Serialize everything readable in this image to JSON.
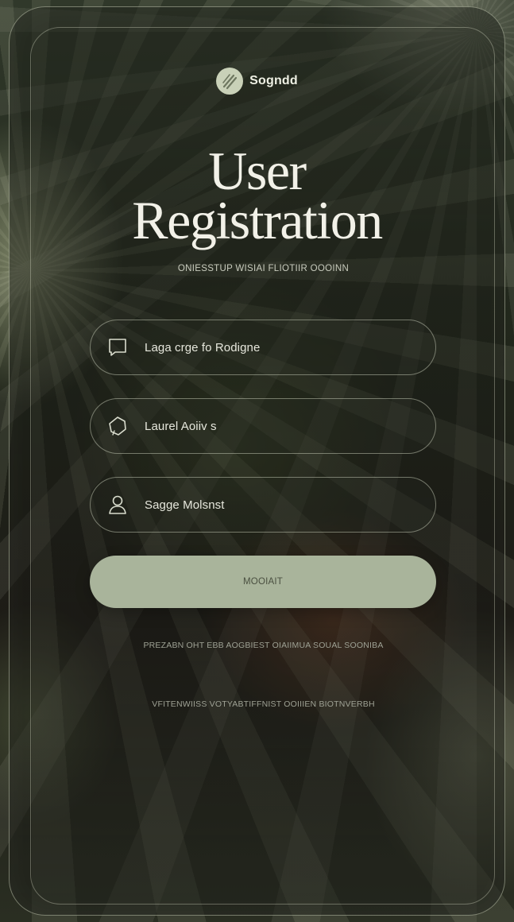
{
  "brand": {
    "name": "Sogndd",
    "logo_icon": "leaf-slash-icon"
  },
  "header": {
    "title_line1": "User",
    "title_line2": "Registration",
    "subtitle": "ONIESSTUP WISIAI FLIOTIIR OOOINN"
  },
  "form": {
    "fields": [
      {
        "icon": "message-square-icon",
        "value": "Laga crge fo Rodigne"
      },
      {
        "icon": "hexagon-badge-icon",
        "value": "Laurel Aoiiv s"
      },
      {
        "icon": "user-icon",
        "value": "Sagge Molsnst"
      }
    ],
    "submit_label": "MOOIAIT"
  },
  "footer": {
    "line1": "PREZABN OHT EBB AOGBIEST OIAIIMUA SOUAL SOONIBA",
    "line2": "VFITENWIISS VOTYABTIFFNIST OOIIIEN BIOTNVERBH"
  },
  "colors": {
    "button_bg": "#a9b49b",
    "text_primary": "#f2f1e8",
    "accent_logo": "#c9d1b8"
  }
}
